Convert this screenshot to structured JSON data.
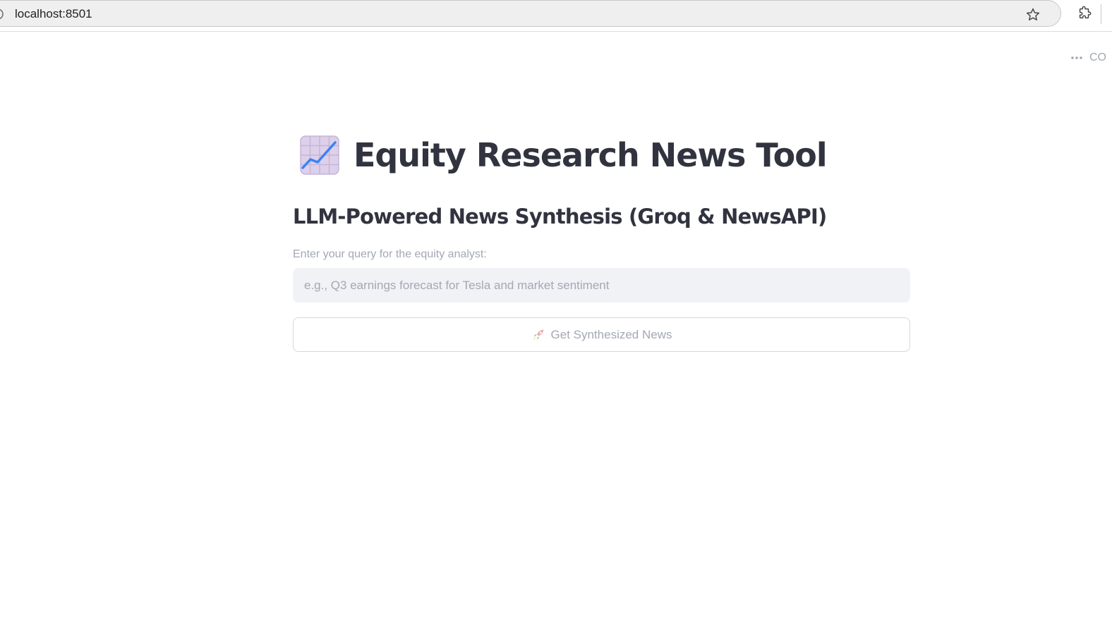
{
  "browser": {
    "url": "localhost:8501",
    "icons": [
      "info-icon",
      "bookmark-star-icon",
      "extensions-puzzle-icon"
    ]
  },
  "app_header": {
    "menu_icon": "more-dots-icon",
    "menu_label": "CO"
  },
  "main": {
    "title_icon": "chart-increasing-emoji",
    "title": "Equity Research News Tool",
    "subtitle": "LLM-Powered News Synthesis (Groq & NewsAPI)",
    "query": {
      "label": "Enter your query for the equity analyst:",
      "value": "",
      "placeholder": "e.g., Q3 earnings forecast for Tesla and market sentiment"
    },
    "submit_button": {
      "icon": "rocket-icon",
      "label": "Get Synthesized News"
    }
  },
  "colors": {
    "text_primary": "#31333f",
    "text_muted": "#a3a8b4",
    "input_bg": "#f0f2f6",
    "border": "#d5d7de",
    "chart_line": "#3b82f6"
  }
}
